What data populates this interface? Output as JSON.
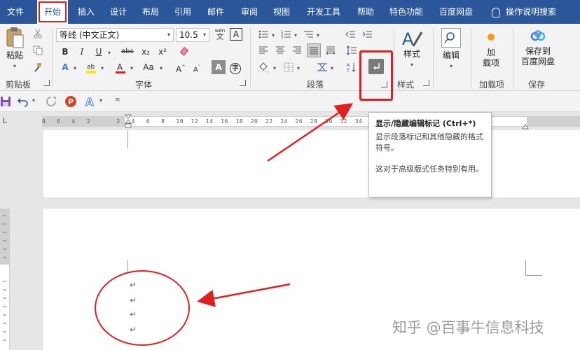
{
  "tabs": [
    {
      "label": "文件",
      "active": false
    },
    {
      "label": "开始",
      "active": true
    },
    {
      "label": "插入",
      "active": false
    },
    {
      "label": "设计",
      "active": false
    },
    {
      "label": "布局",
      "active": false
    },
    {
      "label": "引用",
      "active": false
    },
    {
      "label": "邮件",
      "active": false
    },
    {
      "label": "审阅",
      "active": false
    },
    {
      "label": "视图",
      "active": false
    },
    {
      "label": "开发工具",
      "active": false
    },
    {
      "label": "帮助",
      "active": false
    },
    {
      "label": "特色功能",
      "active": false
    },
    {
      "label": "百度网盘",
      "active": false
    }
  ],
  "tell_me": "操作说明搜索",
  "ribbon": {
    "clipboard": {
      "paste_label": "粘贴",
      "group_label": "剪贴板"
    },
    "font": {
      "font_name": "等线 (中文正文)",
      "font_size": "10.5",
      "wen_glyph": "wén",
      "a_box_glyph": "A",
      "bold": "B",
      "italic": "I",
      "underline": "U",
      "strike": "abc",
      "subscript": "x₂",
      "superscript": "x²",
      "grow": "A",
      "shrink": "A",
      "case": "Aa",
      "group_label": "字体"
    },
    "paragraph": {
      "group_label": "段落"
    },
    "styles": {
      "label": "样式",
      "group_label": "样式"
    },
    "editing": {
      "label": "编辑"
    },
    "addins": {
      "label_line1": "加",
      "label_line2": "载项",
      "group_label": "加载项"
    },
    "save": {
      "label_line1": "保存到",
      "label_line2": "百度网盘",
      "group_label": "保存"
    }
  },
  "ruler": {
    "numbers": "8   6   4   2       2   4   6   8   10  12  14  16  18  20  22  24  26  28  30  32  34  36  38      40  42",
    "corner": "L"
  },
  "tooltip": {
    "title": "显示/隐藏编辑标记 (Ctrl+*)",
    "line1": "显示段落标记和其他隐藏的格式符号。",
    "line2": "这对于高级版式任务特别有用。"
  },
  "document": {
    "paragraph_mark": "↵"
  },
  "watermark": "知乎 @百事牛信息科技",
  "colors": {
    "tab_bar": "#2b579a",
    "annotation_red": "#e02020",
    "highlight_yellow": "#ffe600",
    "font_color_red": "#e02020"
  }
}
